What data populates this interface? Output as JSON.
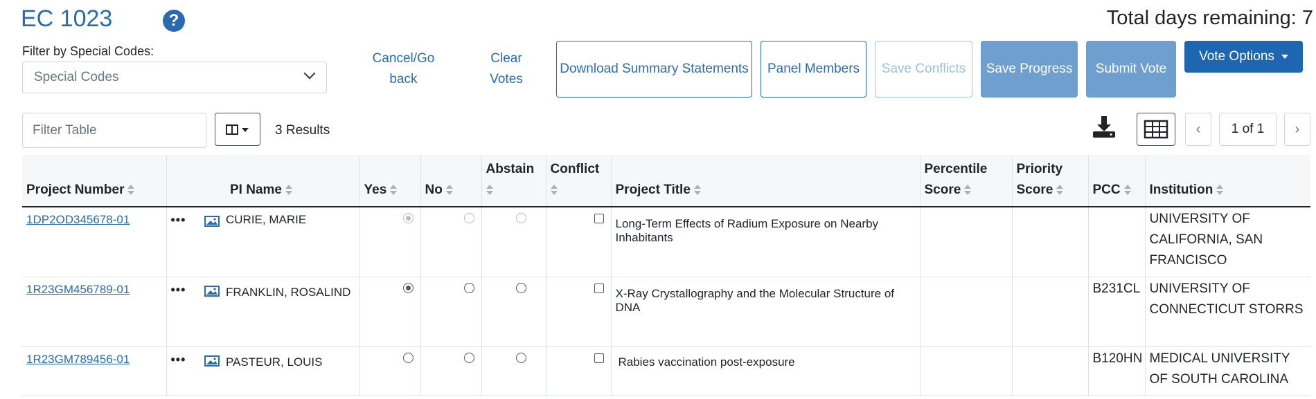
{
  "header": {
    "title": "EC 1023",
    "help_icon": "question-circle-icon",
    "days_remaining": "Total days remaining: 7"
  },
  "filter": {
    "label": "Filter by Special Codes:",
    "placeholder": "Special Codes"
  },
  "actions": {
    "cancel": "Cancel/Go back",
    "clear": "Clear Votes",
    "download": "Download Summary Statements",
    "panel": "Panel Members",
    "save_conflicts": "Save Conflicts",
    "save_progress": "Save Progress",
    "submit": "Submit Vote",
    "vote_options": "Vote Options"
  },
  "table_tools": {
    "filter_placeholder": "Filter Table",
    "results": "3 Results",
    "pagination": "1 of 1"
  },
  "columns": [
    "Project Number",
    "PI Name",
    "Yes",
    "No",
    "Abstain",
    "Conflict",
    "Project Title",
    "Percentile Score",
    "Priority Score",
    "PCC",
    "Institution"
  ],
  "rows": [
    {
      "project_number": "1DP2OD345678-01",
      "pi_name": "CURIE, MARIE",
      "vote": "yes",
      "disabled": true,
      "conflict": false,
      "title": "Long-Term Effects of Radium Exposure on Nearby Inhabitants",
      "percentile": "",
      "priority": "",
      "pcc": "",
      "institution": "UNIVERSITY OF CALIFORNIA, SAN FRANCISCO"
    },
    {
      "project_number": "1R23GM456789-01",
      "pi_name": "FRANKLIN, ROSALIND",
      "vote": "yes",
      "disabled": false,
      "conflict": false,
      "title": "X-Ray Crystallography and the Molecular Structure of DNA",
      "percentile": "",
      "priority": "",
      "pcc": "B231CL",
      "institution": "UNIVERSITY OF CONNECTICUT STORRS"
    },
    {
      "project_number": "1R23GM789456-01",
      "pi_name": "PASTEUR, LOUIS",
      "vote": "",
      "disabled": false,
      "conflict": false,
      "title": "Rabies vaccination post-exposure",
      "percentile": "",
      "priority": "",
      "pcc": "B120HN",
      "institution": "MEDICAL UNIVERSITY OF SOUTH CAROLINA"
    }
  ]
}
